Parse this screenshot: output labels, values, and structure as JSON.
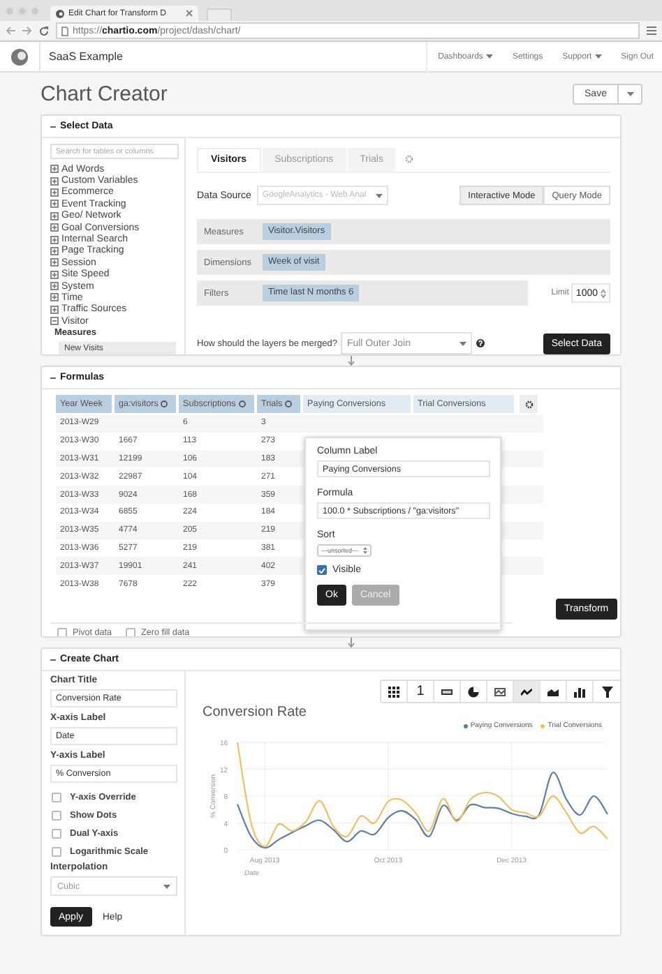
{
  "browser": {
    "tab_title": "Edit Chart for Transform D",
    "url": "https://**chartio.com**/project/dash/chart/"
  },
  "nav": {
    "brand": "SaaS Example",
    "items": [
      {
        "label": "Dashboards",
        "dropdown": true
      },
      {
        "label": "Settings",
        "dropdown": false
      },
      {
        "label": "Support",
        "dropdown": true
      },
      {
        "label": "Sign Out",
        "dropdown": false
      }
    ]
  },
  "page_title": "Chart Creator",
  "save_button": "Save",
  "select_data": {
    "title": "Select Data",
    "search_placeholder": "Search for tables or columns",
    "tree": [
      {
        "label": "Ad Words",
        "expanded": false
      },
      {
        "label": "Custom Variables",
        "expanded": false
      },
      {
        "label": "Ecommerce",
        "expanded": false
      },
      {
        "label": "Event Tracking",
        "expanded": false
      },
      {
        "label": "Geo/ Network",
        "expanded": false
      },
      {
        "label": "Goal Conversions",
        "expanded": false
      },
      {
        "label": "Internal Search",
        "expanded": false
      },
      {
        "label": "Page Tracking",
        "expanded": false
      },
      {
        "label": "Session",
        "expanded": false
      },
      {
        "label": "Site Speed",
        "expanded": false
      },
      {
        "label": "System",
        "expanded": false
      },
      {
        "label": "Time",
        "expanded": false
      },
      {
        "label": "Traffic Sources",
        "expanded": false
      },
      {
        "label": "Visitor",
        "expanded": true,
        "children": [
          {
            "label": "Measures",
            "kind": "heading",
            "children": [
              {
                "label": "New Visits",
                "kind": "field"
              }
            ]
          }
        ]
      }
    ],
    "tabs": [
      {
        "label": "Visitors",
        "selected": true
      },
      {
        "label": "Subscriptions",
        "selected": false
      },
      {
        "label": "Trials",
        "selected": false
      }
    ],
    "data_source": {
      "label": "Data Source",
      "value": "GoogleAnalytics - Web Anal"
    },
    "modes": [
      {
        "label": "Interactive Mode",
        "selected": true
      },
      {
        "label": "Query Mode",
        "selected": false
      }
    ],
    "rows": [
      {
        "label": "Measures",
        "pills": [
          "Visitor.Visitors"
        ]
      },
      {
        "label": "Dimensions",
        "pills": [
          "Week of visit"
        ]
      },
      {
        "label": "Filters",
        "pills": [
          "Time last N months 6"
        ]
      }
    ],
    "limit": {
      "label": "Limit",
      "value": "1000"
    },
    "merge": {
      "label": "How should the layers be merged?",
      "value": "Full Outer Join"
    },
    "select_button": "Select Data"
  },
  "formulas": {
    "title": "Formulas",
    "columns": [
      {
        "label": "Year Week",
        "kind": "source",
        "sortable": false
      },
      {
        "label": "ga:visitors",
        "kind": "source",
        "sortable": true
      },
      {
        "label": "Subscriptions",
        "kind": "source",
        "sortable": true
      },
      {
        "label": "Trials",
        "kind": "source",
        "sortable": true
      },
      {
        "label": "Paying Conversions",
        "kind": "formula",
        "sortable": false
      },
      {
        "label": "Trial Conversions",
        "kind": "formula",
        "sortable": false
      }
    ],
    "rows": [
      [
        "2013-W29",
        null,
        "6",
        "3"
      ],
      [
        "2013-W30",
        "1667",
        "113",
        "273"
      ],
      [
        "2013-W31",
        "12199",
        "106",
        "183"
      ],
      [
        "2013-W32",
        "22987",
        "104",
        "271"
      ],
      [
        "2013-W33",
        "9024",
        "168",
        "359"
      ],
      [
        "2013-W34",
        "6855",
        "224",
        "184"
      ],
      [
        "2013-W35",
        "4774",
        "205",
        "219"
      ],
      [
        "2013-W36",
        "5277",
        "219",
        "381"
      ],
      [
        "2013-W37",
        "19901",
        "241",
        "402"
      ],
      [
        "2013-W38",
        "7678",
        "222",
        "379"
      ]
    ],
    "popover": {
      "column_label": "Column Label",
      "column_value": "Paying Conversions",
      "formula_label": "Formula",
      "formula_value": "100.0 * Subscriptions / \"ga:visitors\"",
      "sort_label": "Sort",
      "sort_value": "---unsorted---",
      "visible": {
        "label": "Visible",
        "checked": true
      },
      "ok": "Ok",
      "cancel": "Cancel"
    },
    "transform_button": "Transform",
    "options": [
      {
        "label": "Pivot data",
        "checked": false
      },
      {
        "label": "Zero fill data",
        "checked": false
      }
    ]
  },
  "create_chart": {
    "title": "Create Chart",
    "fields": [
      {
        "label": "Chart Title",
        "value": "Conversion Rate"
      },
      {
        "label": "X-axis Label",
        "value": "Date"
      },
      {
        "label": "Y-axis Label",
        "value": "% Conversion"
      }
    ],
    "options": [
      {
        "label": "Y-axis Override",
        "checked": false
      },
      {
        "label": "Show Dots",
        "checked": false
      },
      {
        "label": "Dual Y-axis",
        "checked": false
      },
      {
        "label": "Logarithmic Scale",
        "checked": false
      }
    ],
    "interpolation": {
      "label": "Interpolation",
      "value": "Cubic"
    },
    "apply_button": "Apply",
    "help_link": "Help",
    "chart_types": [
      {
        "kind": "grid",
        "selected": false
      },
      {
        "kind": "number",
        "label": "1",
        "selected": false
      },
      {
        "kind": "bar",
        "selected": false
      },
      {
        "kind": "pie",
        "selected": false
      },
      {
        "kind": "map",
        "selected": false
      },
      {
        "kind": "line",
        "selected": true
      },
      {
        "kind": "area",
        "selected": false
      },
      {
        "kind": "column",
        "selected": false
      },
      {
        "kind": "funnel",
        "selected": false
      }
    ],
    "chart_data": {
      "type": "line",
      "title": "Conversion Rate",
      "xlabel": "Date",
      "ylabel": "% Conversion",
      "categories": [
        null,
        null,
        "Aug 2013",
        null,
        null,
        null,
        null,
        null,
        null,
        null,
        null,
        "Oct 2013",
        null,
        null,
        null,
        null,
        null,
        null,
        null,
        null,
        "Dec 2013",
        null,
        null,
        null,
        null,
        null,
        null,
        null
      ],
      "series": [
        {
          "name": "Paying Conversions",
          "color": "#5b7fa6",
          "values": [
            6.8,
            2,
            0.3,
            1.5,
            2.6,
            3.6,
            4.4,
            3,
            1.2,
            2.8,
            2.3,
            4.8,
            5.8,
            4.5,
            2,
            6.6,
            4.4,
            6.7,
            6.3,
            6.2,
            5.4,
            5,
            5.2,
            11.5,
            7.5,
            5.2,
            8,
            5.3
          ]
        },
        {
          "name": "Trial Conversions",
          "color": "#f0c060",
          "values": [
            16,
            4,
            0.5,
            3.8,
            2.8,
            4.2,
            7.3,
            3.5,
            2,
            5,
            4,
            7.2,
            7.4,
            5.5,
            2.8,
            7.6,
            4.2,
            7.5,
            8.5,
            8,
            6,
            5.5,
            5,
            8,
            5.5,
            2.5,
            3.5,
            1.6
          ]
        }
      ],
      "ylim": [
        0,
        16
      ],
      "grid": true,
      "yticks": [
        0,
        4,
        8,
        12,
        16
      ]
    }
  }
}
